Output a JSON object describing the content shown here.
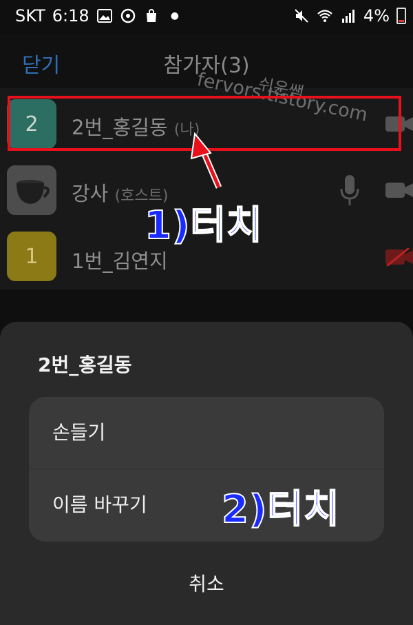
{
  "status_bar": {
    "carrier": "SKT",
    "time": "6:18",
    "battery": "4%"
  },
  "header": {
    "close_label": "닫기",
    "title": "참가자(3)"
  },
  "watermark": {
    "line1": "쉬운쌤",
    "line2": "fervors.tistory.com"
  },
  "participants": [
    {
      "initial": "2",
      "name": "2번_홍길동",
      "tag": "(나)",
      "avatar_color": "#2c6e62",
      "camera": "on"
    },
    {
      "initial": "",
      "name": "강사",
      "tag": "(호스트)",
      "avatar_color": "#555555",
      "camera": "on",
      "mic": "on"
    },
    {
      "initial": "1",
      "name": "1번_김연지",
      "tag": "",
      "avatar_color": "#8b7a16",
      "camera": "off"
    }
  ],
  "annotations": {
    "step1": "1)터치",
    "step2": "2)터치",
    "highlight_color": "#e8101a",
    "text_color": "#1a2bff"
  },
  "sheet": {
    "title": "2번_홍길동",
    "options": [
      "손들기",
      "이름 바꾸기"
    ],
    "cancel": "취소"
  }
}
